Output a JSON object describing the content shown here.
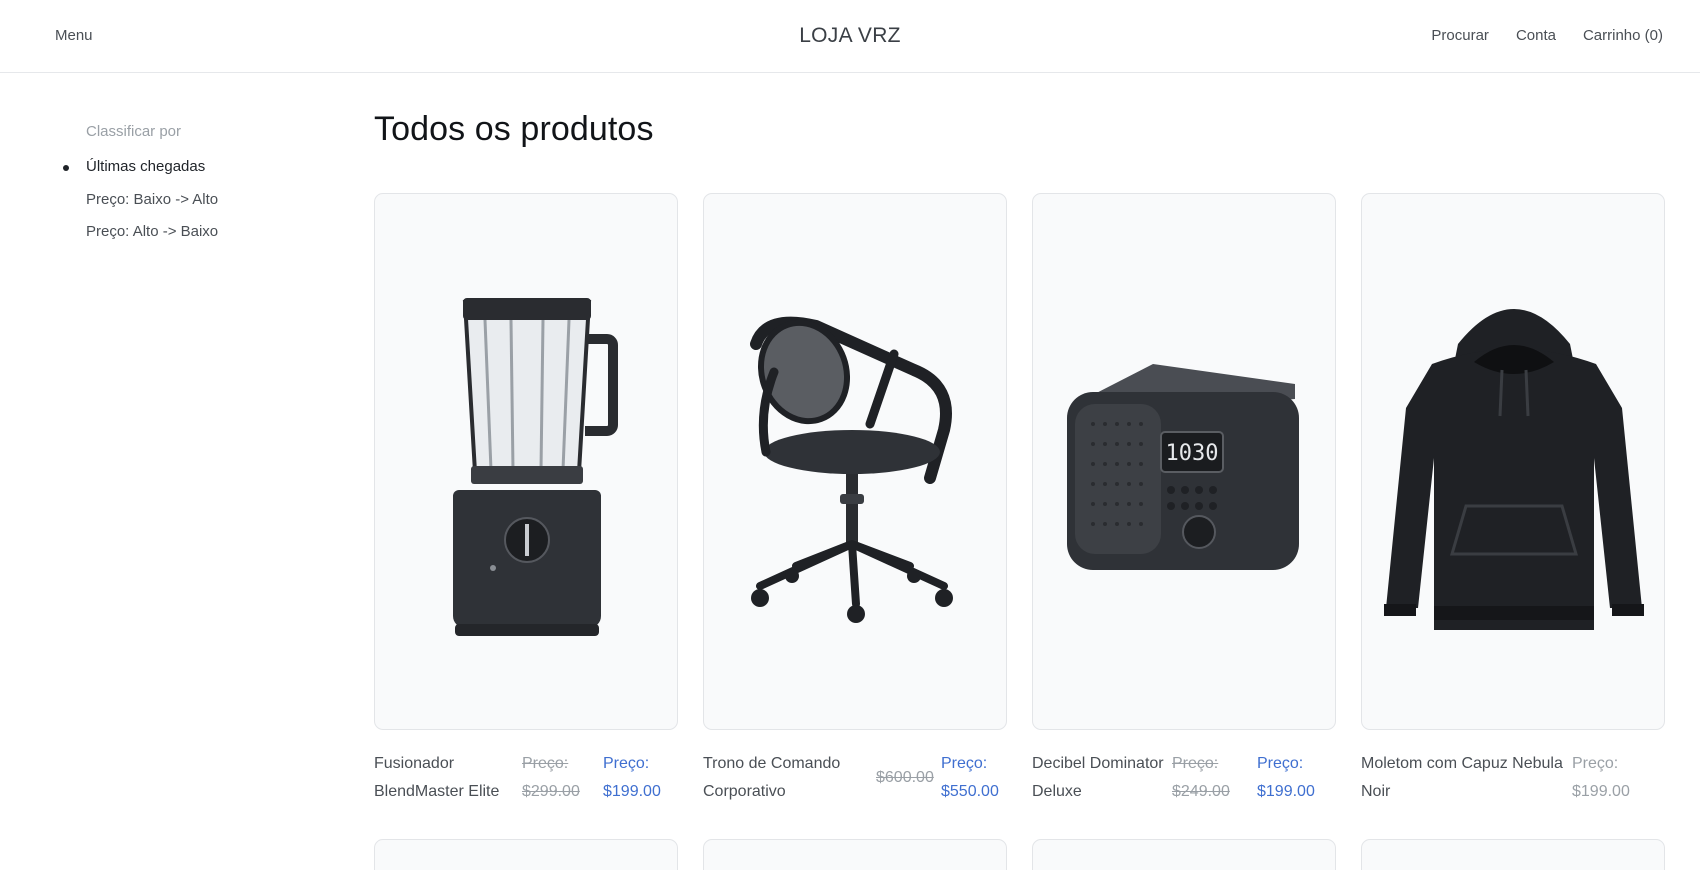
{
  "header": {
    "menu_label": "Menu",
    "brand": "LOJA VRZ",
    "search_label": "Procurar",
    "account_label": "Conta",
    "cart_label": "Carrinho (0)"
  },
  "sidebar": {
    "sort_title": "Classificar por",
    "options": [
      {
        "label": "Últimas chegadas",
        "active": true
      },
      {
        "label": "Preço: Baixo -> Alto",
        "active": false
      },
      {
        "label": "Preço: Alto -> Baixo",
        "active": false
      }
    ]
  },
  "main": {
    "title": "Todos os produtos",
    "products": [
      {
        "name_line1": "Fusionador",
        "name_line2": "BlendMaster Elite",
        "old_line1": "Preço:",
        "old_line2": "$299.00",
        "new_line1": "Preço:",
        "new_line2": "$199.00",
        "icon": "blender-icon"
      },
      {
        "name_line1": "Trono de Comando",
        "name_line2": "Corporativo",
        "old_line1": "",
        "old_line2": "$600.00",
        "new_line1": "Preço:",
        "new_line2": "$550.00",
        "icon": "office-chair-icon"
      },
      {
        "name_line1": "Decibel Dominator",
        "name_line2": "Deluxe",
        "old_line1": "Preço:",
        "old_line2": "$249.00",
        "new_line1": "Preço:",
        "new_line2": "$199.00",
        "clock_display": "1030",
        "icon": "radio-clock-icon"
      },
      {
        "name_line1": "Moletom com Capuz Nebula",
        "name_line2": "Noir",
        "old_line1": "",
        "old_line2": "",
        "new_line1": "Preço:",
        "new_line2": "$199.00",
        "icon": "hoodie-icon"
      }
    ]
  },
  "colors": {
    "accent_price": "#3f6fd0",
    "muted": "#9aa0a6",
    "card_bg": "#f9fafb"
  }
}
